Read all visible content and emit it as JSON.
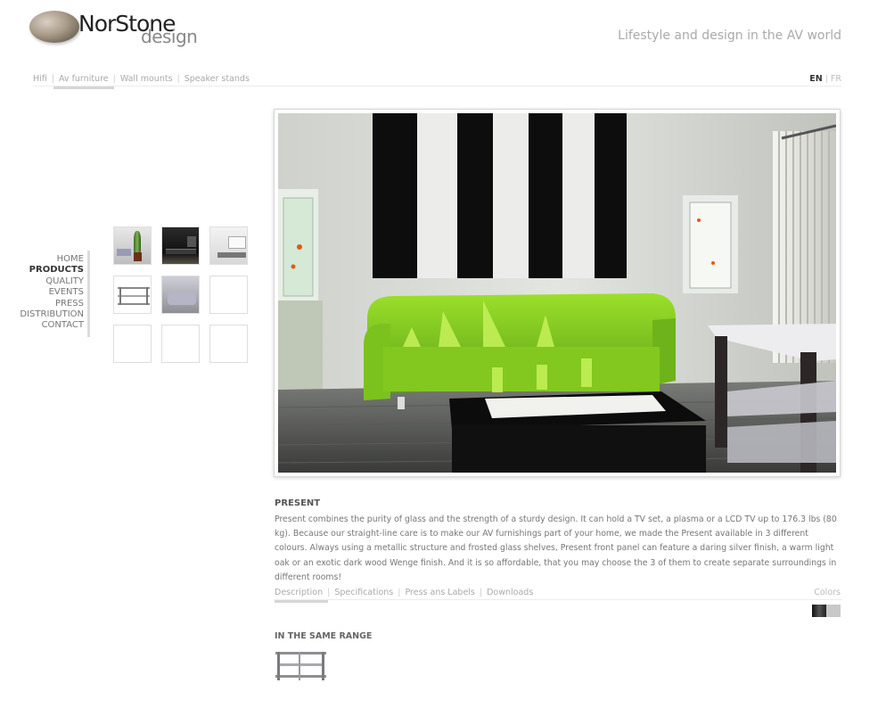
{
  "header": {
    "logo_nor": "NorStone",
    "logo_design": "design",
    "tagline": "Lifestyle and design in the AV world"
  },
  "topnav": {
    "items": [
      {
        "label": "Hifi"
      },
      {
        "label": "Av furniture",
        "active": true
      },
      {
        "label": "Wall mounts"
      },
      {
        "label": "Speaker stands"
      }
    ]
  },
  "lang": {
    "en": "EN",
    "fr": "FR"
  },
  "leftmenu": {
    "items": [
      "HOME",
      "PRODUCTS",
      "QUALITY",
      "EVENTS",
      "PRESS",
      "DISTRIBUTION",
      "CONTACT"
    ],
    "active": "PRODUCTS"
  },
  "thumbs": [
    "plant-room-thumb",
    "dark-cabinet-thumb",
    "white-tv-stand-thumb",
    "glass-rack-thumb",
    "grey-sofa-thumb",
    "empty",
    "empty",
    "empty",
    "empty"
  ],
  "product": {
    "title": "PRESENT",
    "description": "Present combines the purity of glass and the strength of a sturdy design. It can hold a TV set, a plasma or a LCD TV up to 176.3 lbs (80 kg). Because our straight-line care is to make our AV furnishings part of your home, we made the Present available in 3 different colours. Always using a metallic structure and frosted glass shelves, Present front panel can feature a daring silver finish, a warm light oak or an exotic dark wood Wenge finish. And it is so affordable, that you may choose the 3 of them to create separate surroundings in different rooms!"
  },
  "tabs": {
    "items": [
      {
        "label": "Description",
        "active": true
      },
      {
        "label": "Specifications"
      },
      {
        "label": "Press ans Labels"
      },
      {
        "label": "Downloads"
      }
    ],
    "colors_label": "Colors",
    "swatches": [
      "#2a2a2a",
      "#c8c8c8"
    ]
  },
  "range": {
    "title": "IN THE SAME RANGE"
  },
  "colors": {
    "accent_green": "#8fd61f",
    "text": "#777777"
  }
}
